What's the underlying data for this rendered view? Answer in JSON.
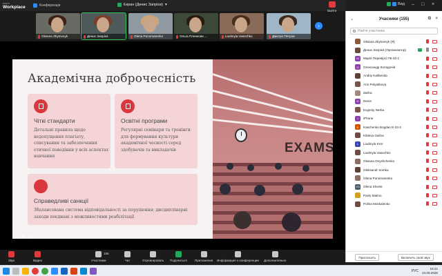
{
  "app": {
    "zoom_label": "zoom",
    "workplace_label": "Workplace"
  },
  "topbar": {
    "conference_label": "Конференція",
    "share_title": "Екран (Денис Запрієв)",
    "view_label": "Вид"
  },
  "thumbnails": [
    {
      "name": "Oksana Zbytovnyk"
    },
    {
      "name": "Денис Запрієв"
    },
    {
      "name": "Olena Ponomarenko"
    },
    {
      "name": "Ольга Пленкова ..."
    },
    {
      "name": "Liudmyla Vasechko"
    },
    {
      "name": "Дмитро Петров"
    }
  ],
  "slide": {
    "title": "Академічна доброчесність",
    "cards": [
      {
        "title": "Чіткі стандарти",
        "desc": [
          "Детальні правила щодо",
          "недопущення плагіату,",
          "списування та забезпечення",
          "етичної поведінки у всіх аспектах",
          "навчання"
        ]
      },
      {
        "title": "Освітні програми",
        "desc": [
          "Регулярні семінари та тренінги",
          "для формування культури",
          "академічної чесності серед",
          "здобувачів та викладачів"
        ]
      },
      {
        "title": "Справедливі санкції",
        "desc": [
          "Збалансована система відповідальності за порушення: дисциплінарні",
          "заходи поєднані з можливостями реабілітації"
        ]
      }
    ],
    "photo_sign": "EXAMS"
  },
  "panel": {
    "title": "Учасники (155)",
    "search_placeholder": "Найти участника",
    "participants": [
      {
        "name": "Oksana Zbytovnyk (Я)",
        "color": "#8a5a3a"
      },
      {
        "name": "Денис Запрієв (Организатор)",
        "color": "#6a4a3a"
      },
      {
        "name": "Марія Перевірсі ПК-23-1",
        "color": "#8e44ad",
        "letter": "M"
      },
      {
        "name": "Олександр Колодочій",
        "color": "#8e44ad",
        "letter": "O"
      },
      {
        "name": "Andriy Kalibenda",
        "color": "#5d4037"
      },
      {
        "name": "Ann Polyakbova",
        "color": "#795548"
      },
      {
        "name": "dasha",
        "color": "#a1887f"
      },
      {
        "name": "Denis",
        "color": "#8e44ad",
        "letter": "D"
      },
      {
        "name": "Evgeniy Nerba",
        "color": "#795548"
      },
      {
        "name": "iPhone",
        "color": "#8e44ad",
        "letter": "I"
      },
      {
        "name": "Kaschenko Bogdan Е-23-2",
        "color": "#d35400",
        "letter": "K"
      },
      {
        "name": "Kildeva Galina",
        "color": "#6d4c41"
      },
      {
        "name": "Liudmyla Krot",
        "color": "#3949ab",
        "letter": "L"
      },
      {
        "name": "Liudmyla Vasechko",
        "color": "#6d4c41"
      },
      {
        "name": "Oksana Onyshchenko",
        "color": "#8d6e63"
      },
      {
        "name": "Oleksandr Somka",
        "color": "#5d4037"
      },
      {
        "name": "Olena Ponomarenko",
        "color": "#8d6e63"
      },
      {
        "name": "Olena Shvets",
        "color": "#455a64",
        "letter": "OS"
      },
      {
        "name": "Pavlo Malmo",
        "color": "#d4a017"
      },
      {
        "name": "Polina Moskalenko",
        "color": "#6d4c41"
      }
    ],
    "invite_label": "Пригласить",
    "unmute_label": "Включить свой звук"
  },
  "toolbar": {
    "items": [
      {
        "label": "Звук",
        "kind": "red"
      },
      {
        "label": "Видео",
        "kind": "red"
      },
      {
        "label": "Участники",
        "count": "155"
      },
      {
        "label": "Чат"
      },
      {
        "label": "Отреагировать"
      },
      {
        "label": "Поделиться",
        "kind": "green"
      },
      {
        "label": "Приложения"
      },
      {
        "label": "Информация о конференции"
      },
      {
        "label": "Дополнительно"
      }
    ],
    "leave_label": "Выйти"
  },
  "taskbar": {
    "lang": "РУС",
    "time": "16:41",
    "date": "24.05.2025"
  }
}
